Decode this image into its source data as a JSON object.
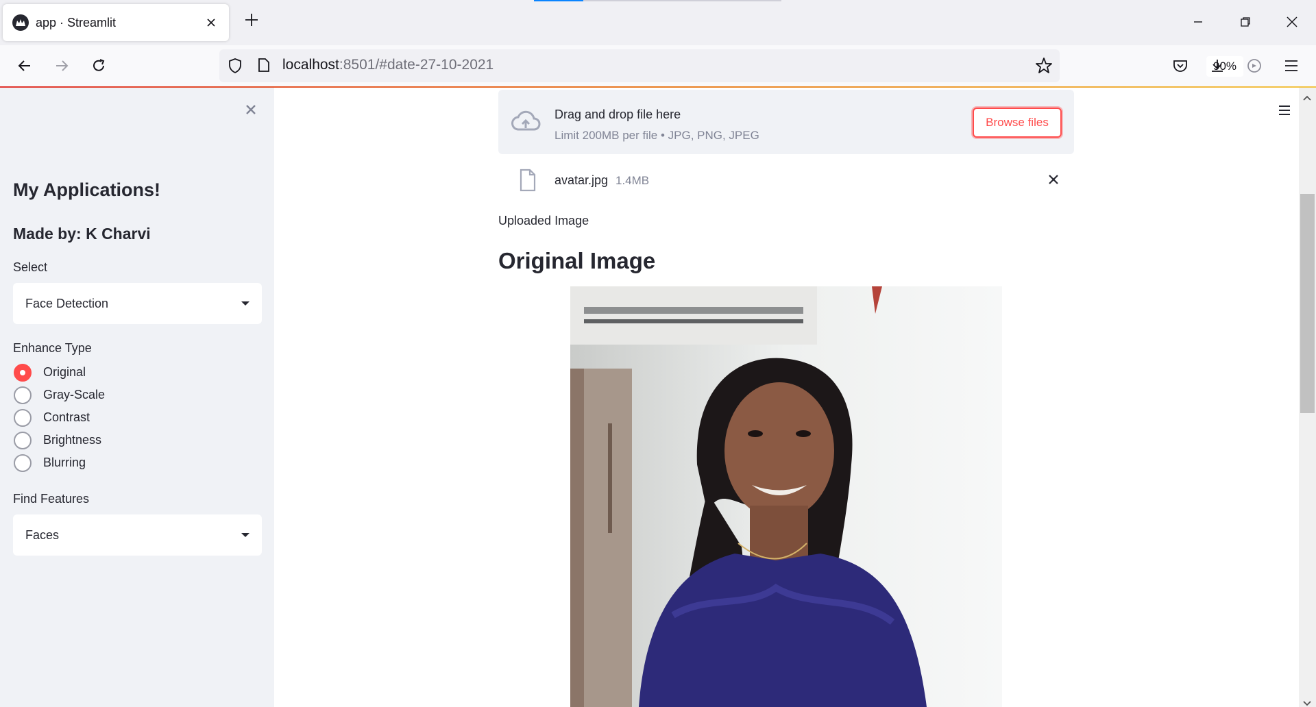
{
  "browser": {
    "tab_title": "app · Streamlit",
    "url_host": "localhost",
    "url_rest": ":8501/#date-27-10-2021",
    "zoom": "90%"
  },
  "sidebar": {
    "heading": "My Applications!",
    "subheading": "Made by: K Charvi",
    "select_label": "Select",
    "select_value": "Face Detection",
    "enhance_label": "Enhance Type",
    "radio_options": [
      {
        "label": "Original",
        "selected": true
      },
      {
        "label": "Gray-Scale",
        "selected": false
      },
      {
        "label": "Contrast",
        "selected": false
      },
      {
        "label": "Brightness",
        "selected": false
      },
      {
        "label": "Blurring",
        "selected": false
      }
    ],
    "features_label": "Find Features",
    "features_value": "Faces"
  },
  "uploader": {
    "title": "Drag and drop file here",
    "limit": "Limit 200MB per file • JPG, PNG, JPEG",
    "browse_label": "Browse files",
    "file_name": "avatar.jpg",
    "file_size": "1.4MB"
  },
  "main": {
    "uploaded_text": "Uploaded Image",
    "section_title": "Original Image"
  },
  "colors": {
    "accent": "#ff4b4b",
    "sidebar_bg": "#f0f2f6",
    "text": "#262730"
  }
}
